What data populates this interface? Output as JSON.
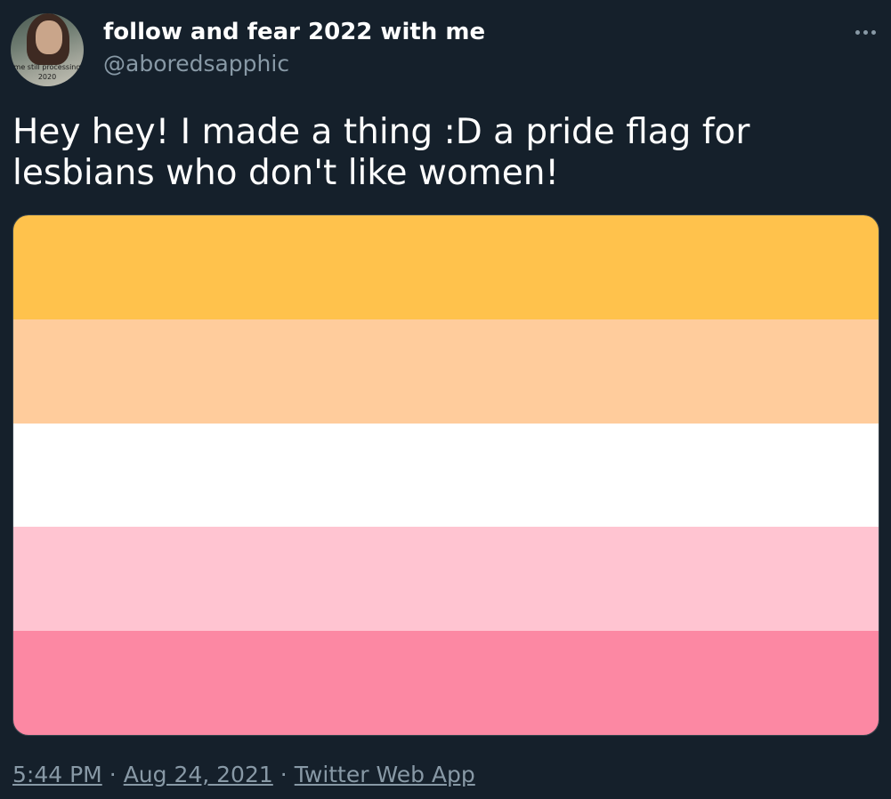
{
  "author": {
    "display_name": "follow and fear 2022 with me",
    "handle": "@aboredsapphic",
    "avatar_caption_line1": "me still processing",
    "avatar_caption_line2": "2020"
  },
  "tweet": {
    "text": "Hey hey! I made a thing :D a pride flag for lesbians who don't like women!",
    "more_icon": "more-horizontal-icon"
  },
  "flag": {
    "stripes": [
      "#ffc24c",
      "#ffcc9c",
      "#ffffff",
      "#ffc4d1",
      "#fc88a3"
    ]
  },
  "meta": {
    "time": "5:44 PM",
    "date": "Aug 24, 2021",
    "source": "Twitter Web App",
    "separator": "·"
  }
}
